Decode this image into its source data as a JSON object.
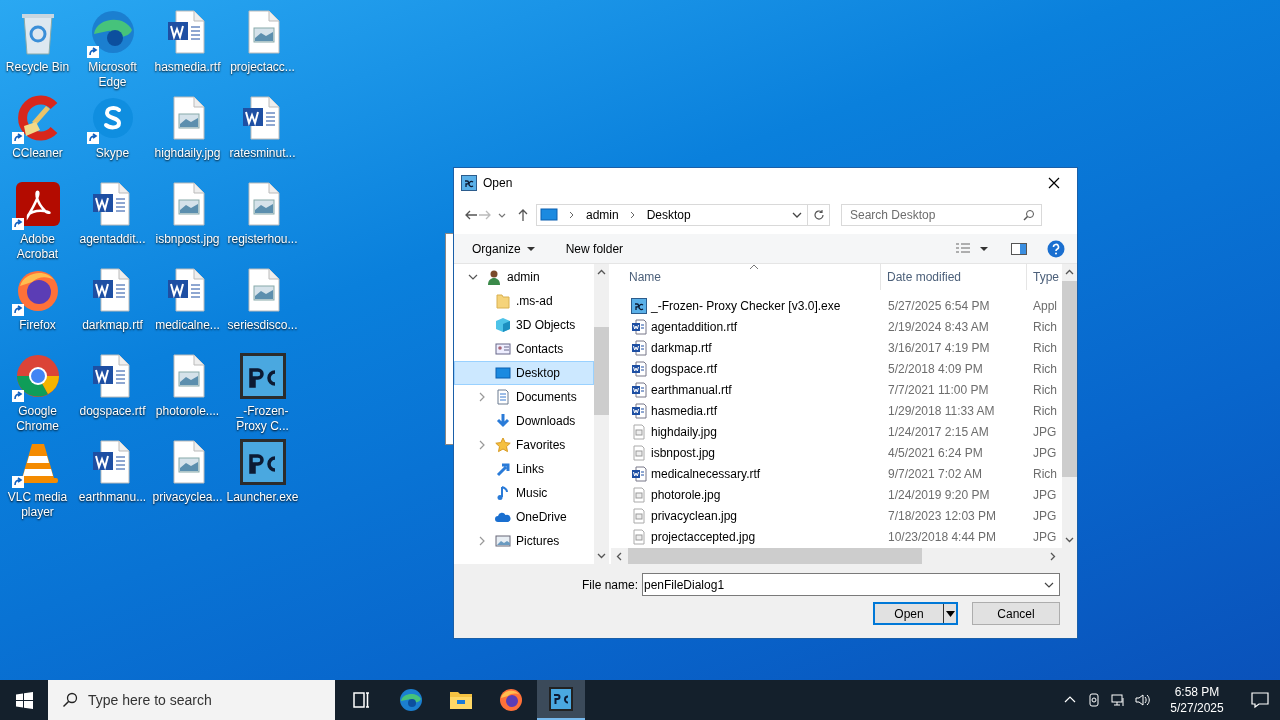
{
  "desktop_icons": [
    {
      "label": "Recycle Bin",
      "kind": "recycle",
      "shortcut": false
    },
    {
      "label": "CCleaner",
      "kind": "ccleaner",
      "shortcut": true
    },
    {
      "label": "Adobe Acrobat",
      "kind": "acrobat",
      "shortcut": true
    },
    {
      "label": "Firefox",
      "kind": "firefox",
      "shortcut": true
    },
    {
      "label": "Google Chrome",
      "kind": "chrome",
      "shortcut": true
    },
    {
      "label": "VLC media player",
      "kind": "vlc",
      "shortcut": true
    },
    {
      "label": "Microsoft Edge",
      "kind": "edge",
      "shortcut": true
    },
    {
      "label": "Skype",
      "kind": "skype",
      "shortcut": true
    },
    {
      "label": "agentaddit...",
      "kind": "word",
      "shortcut": false
    },
    {
      "label": "darkmap.rtf",
      "kind": "word",
      "shortcut": false
    },
    {
      "label": "dogspace.rtf",
      "kind": "word",
      "shortcut": false
    },
    {
      "label": "earthmanu...",
      "kind": "word",
      "shortcut": false
    },
    {
      "label": "hasmedia.rtf",
      "kind": "word",
      "shortcut": false
    },
    {
      "label": "highdaily.jpg",
      "kind": "image",
      "shortcut": false
    },
    {
      "label": "isbnpost.jpg",
      "kind": "image",
      "shortcut": false
    },
    {
      "label": "medicalne...",
      "kind": "word",
      "shortcut": false
    },
    {
      "label": "photorole....",
      "kind": "image",
      "shortcut": false
    },
    {
      "label": "privacyclea...",
      "kind": "image",
      "shortcut": false
    },
    {
      "label": "projectacc...",
      "kind": "image",
      "shortcut": false
    },
    {
      "label": "ratesminut...",
      "kind": "word",
      "shortcut": false
    },
    {
      "label": "registerhou...",
      "kind": "image",
      "shortcut": false
    },
    {
      "label": "seriesdisco...",
      "kind": "image",
      "shortcut": false
    },
    {
      "label": "_-Frozen- Proxy C...",
      "kind": "pc",
      "shortcut": false
    },
    {
      "label": "Launcher.exe",
      "kind": "pc",
      "shortcut": false
    }
  ],
  "dialog": {
    "title": "Open",
    "address": [
      "admin",
      "Desktop"
    ],
    "search": {
      "placeholder": "Search Desktop"
    },
    "toolbar": [
      "Organize",
      "New folder"
    ],
    "tree": [
      {
        "label": "admin",
        "kind": "user",
        "expandable": true,
        "expanded": true,
        "selected": false,
        "children": [
          {
            "label": ".ms-ad",
            "kind": "folder",
            "expandable": false,
            "selected": false
          },
          {
            "label": "3D Objects",
            "kind": "cube",
            "expandable": false,
            "selected": false
          },
          {
            "label": "Contacts",
            "kind": "contacts",
            "expandable": false,
            "selected": false
          },
          {
            "label": "Desktop",
            "kind": "desktop",
            "expandable": false,
            "selected": true
          },
          {
            "label": "Documents",
            "kind": "documents",
            "expandable": true,
            "expanded": false,
            "selected": false
          },
          {
            "label": "Downloads",
            "kind": "downloads",
            "expandable": false,
            "selected": false
          },
          {
            "label": "Favorites",
            "kind": "star",
            "expandable": true,
            "expanded": false,
            "selected": false
          },
          {
            "label": "Links",
            "kind": "links",
            "expandable": false,
            "selected": false
          },
          {
            "label": "Music",
            "kind": "music",
            "expandable": false,
            "selected": false
          },
          {
            "label": "OneDrive",
            "kind": "cloud",
            "expandable": false,
            "selected": false
          },
          {
            "label": "Pictures",
            "kind": "pictures",
            "expandable": true,
            "expanded": false,
            "selected": false
          }
        ]
      }
    ],
    "columns": [
      "Name",
      "Date modified",
      "Type"
    ],
    "files": [
      {
        "name": "_-Frozen- Proxy Checker [v3.0].exe",
        "date": "5/27/2025 6:54 PM",
        "type": "Appl",
        "kind": "exe"
      },
      {
        "name": "agentaddition.rtf",
        "date": "2/19/2024 8:43 AM",
        "type": "Rich",
        "kind": "rtf"
      },
      {
        "name": "darkmap.rtf",
        "date": "3/16/2017 4:19 PM",
        "type": "Rich",
        "kind": "rtf"
      },
      {
        "name": "dogspace.rtf",
        "date": "5/2/2018 4:09 PM",
        "type": "Rich",
        "kind": "rtf"
      },
      {
        "name": "earthmanual.rtf",
        "date": "7/7/2021 11:00 PM",
        "type": "Rich",
        "kind": "rtf"
      },
      {
        "name": "hasmedia.rtf",
        "date": "1/29/2018 11:33 AM",
        "type": "Rich",
        "kind": "rtf"
      },
      {
        "name": "highdaily.jpg",
        "date": "1/24/2017 2:15 AM",
        "type": "JPG",
        "kind": "jpg"
      },
      {
        "name": "isbnpost.jpg",
        "date": "4/5/2021 6:24 PM",
        "type": "JPG",
        "kind": "jpg"
      },
      {
        "name": "medicalnecessary.rtf",
        "date": "9/7/2021 7:02 AM",
        "type": "Rich",
        "kind": "rtf"
      },
      {
        "name": "photorole.jpg",
        "date": "1/24/2019 9:20 PM",
        "type": "JPG",
        "kind": "jpg"
      },
      {
        "name": "privacyclean.jpg",
        "date": "7/18/2023 12:03 PM",
        "type": "JPG",
        "kind": "jpg"
      },
      {
        "name": "projectaccepted.jpg",
        "date": "10/23/2018 4:44 PM",
        "type": "JPG",
        "kind": "jpg"
      }
    ],
    "file_name": {
      "label": "File name:",
      "value": "penFileDialog1"
    },
    "buttons": [
      {
        "label": "Open",
        "default": true
      },
      {
        "label": "Cancel",
        "default": false
      }
    ]
  },
  "taskbar": {
    "search": {
      "placeholder": "Type here to search"
    },
    "apps": [
      {
        "kind": "taskview",
        "active": false
      },
      {
        "kind": "edge",
        "active": false
      },
      {
        "kind": "explorer",
        "active": false
      },
      {
        "kind": "firefox",
        "active": false
      },
      {
        "kind": "pc",
        "active": true
      }
    ],
    "time": "6:58 PM",
    "date": "5/27/2025"
  }
}
